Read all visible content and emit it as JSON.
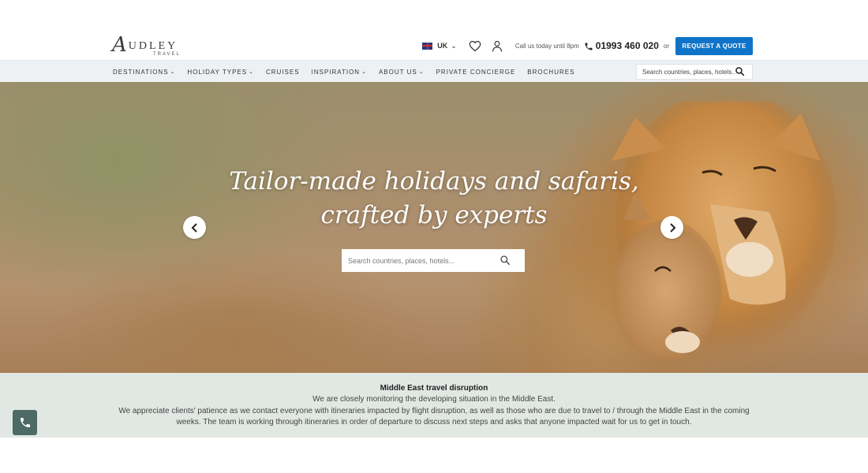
{
  "logo": {
    "initial": "A",
    "wordmark": "UDLEY",
    "sub": "TRAVEL"
  },
  "header": {
    "country": "UK",
    "callus": "Call us today until 8pm",
    "phone": "01993 460 020",
    "or": "or",
    "quote": "REQUEST A QUOTE"
  },
  "nav": {
    "items": [
      {
        "label": "DESTINATIONS",
        "dropdown": true
      },
      {
        "label": "HOLIDAY TYPES",
        "dropdown": true
      },
      {
        "label": "CRUISES",
        "dropdown": false
      },
      {
        "label": "INSPIRATION",
        "dropdown": true
      },
      {
        "label": "ABOUT US",
        "dropdown": true
      },
      {
        "label": "PRIVATE CONCIERGE",
        "dropdown": false
      },
      {
        "label": "BROCHURES",
        "dropdown": false
      }
    ],
    "search_placeholder": "Search countries, places, hotels..."
  },
  "hero": {
    "title_line1": "Tailor-made holidays and safaris,",
    "title_line2": "crafted by experts",
    "search_placeholder": "Search countries, places, hotels..."
  },
  "notice": {
    "title": "Middle East travel disruption",
    "line1": "We are closely monitoring the developing situation in the Middle East.",
    "line2": "We appreciate clients' patience as we contact everyone with itineraries impacted by flight disruption, as well as those who are due to travel to / through the Middle East in the coming weeks. The team is working through itineraries in order of departure to discuss next steps and asks that anyone impacted wait for us to get in touch."
  },
  "colors": {
    "accent": "#0f74c9",
    "notice_bg": "#e1e8e3",
    "nav_bg": "#eef1f3",
    "float_button": "#4d6a64"
  },
  "icons": [
    "uk-flag-icon",
    "heart-icon",
    "user-icon",
    "phone-icon",
    "search-icon",
    "chevron-left-icon",
    "chevron-right-icon"
  ]
}
